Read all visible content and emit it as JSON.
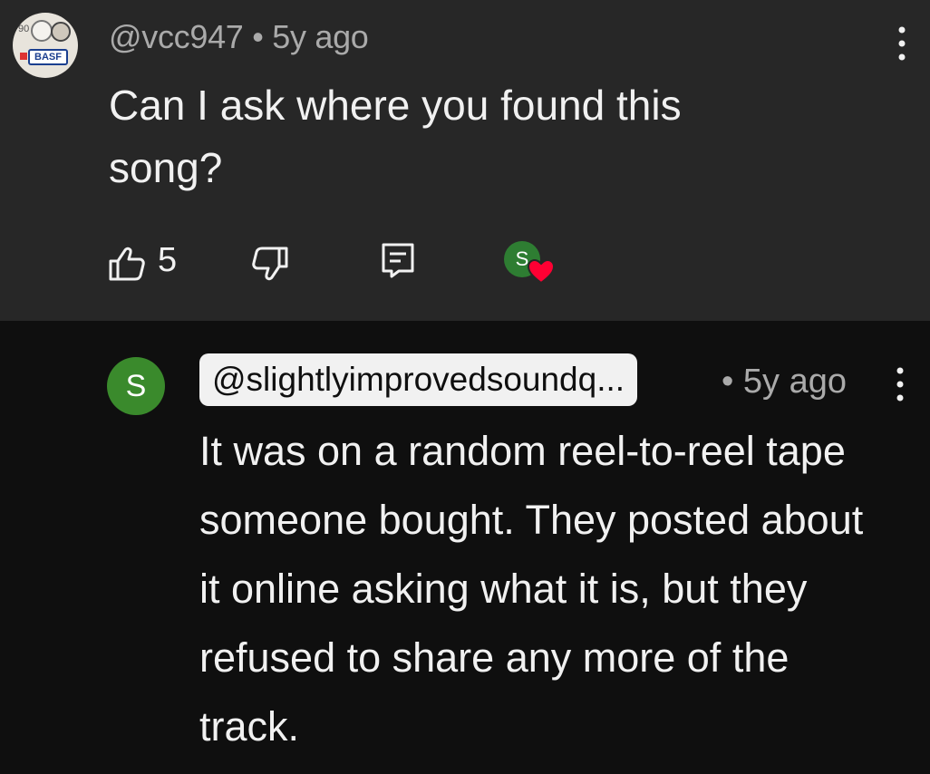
{
  "comment": {
    "avatar": {
      "icon": "tape-reel-avatar",
      "corner_number": "90",
      "logo_text": "BASF"
    },
    "author": "@vcc947",
    "separator": "•",
    "time": "5y ago",
    "text": "Can I ask where you found this song?",
    "likes": "5",
    "icons": [
      "thumbs-up-icon",
      "thumbs-down-icon",
      "reply-icon",
      "more-vert-icon",
      "heart-icon"
    ],
    "creator_heart": {
      "avatar_letter": "S",
      "avatar_color": "#2e7d32",
      "heart_color": "#ff0033"
    }
  },
  "reply": {
    "avatar_letter": "S",
    "avatar_color": "#3a8a2c",
    "author": "@slightlyimprovedsoundq...",
    "separator": "•",
    "time": "5y ago",
    "text": "It was on a random reel-to-reel tape someone bought. They posted about it online asking what it is, but they refused to share any more of the track."
  },
  "theme": {
    "top_bg": "#272727",
    "bottom_bg": "#0f0f0f",
    "text": "#f1f1f1",
    "muted": "#aaaaaa"
  }
}
